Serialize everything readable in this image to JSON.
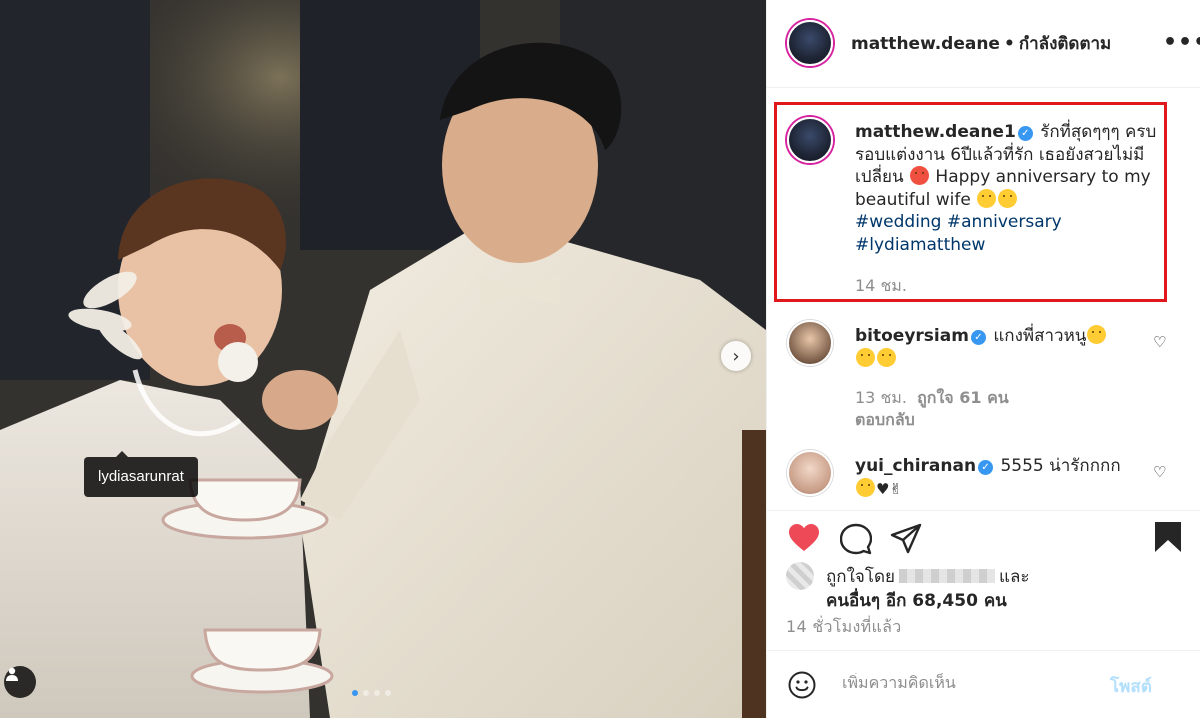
{
  "photo": {
    "tag_username": "lydiasarunrat",
    "carousel_dots": 4,
    "carousel_active_index": 0
  },
  "header": {
    "username": "matthew.deane",
    "separator": "•",
    "follow_status": "กำลังติดตาม",
    "more_label": "•••"
  },
  "caption": {
    "username": "matthew.deane1",
    "verified": "✓",
    "text_1": "รักที่สุดๆๆๆ ครบรอบแต่งงาน 6ปีแล้วที่รัก เธอยังสวยไม่มีเปลี่ยน",
    "text_2": "Happy anniversary to my beautiful wife",
    "hashtags": [
      "#wedding",
      "#anniversary",
      "#lydiamatthew"
    ],
    "time": "14 ชม."
  },
  "comments": [
    {
      "username": "bitoeyrsiam",
      "verified": "✓",
      "text": "แกงพี่สาวหนู",
      "time": "13 ชม.",
      "likes": "ถูกใจ 61 คน",
      "reply": "ตอบกลับ"
    },
    {
      "username": "yui_chiranan",
      "verified": "✓",
      "text": "5555 น่ารักกกก"
    }
  ],
  "likes_line": {
    "prefix": "ถูกใจโดย",
    "suffix": "และ",
    "others": "คนอื่นๆ อีก 68,450 คน"
  },
  "time_ago": "14 ชั่วโมงที่แล้ว",
  "add_comment": {
    "placeholder": "เพิ่มความคิดเห็น",
    "post_label": "โพสต์"
  },
  "icons": {
    "like": "heart-icon",
    "comment": "comment-icon",
    "share": "paper-plane-icon",
    "save": "bookmark-icon",
    "emoji": "smiley-icon",
    "tag": "user-tag-icon",
    "next": "chevron-right-icon"
  },
  "colors": {
    "like_red": "#ed4956",
    "link_blue": "#00376b",
    "highlight_box": "#e0181b",
    "post_button_disabled": "#b2dffc",
    "verified_blue": "#3897f0"
  }
}
